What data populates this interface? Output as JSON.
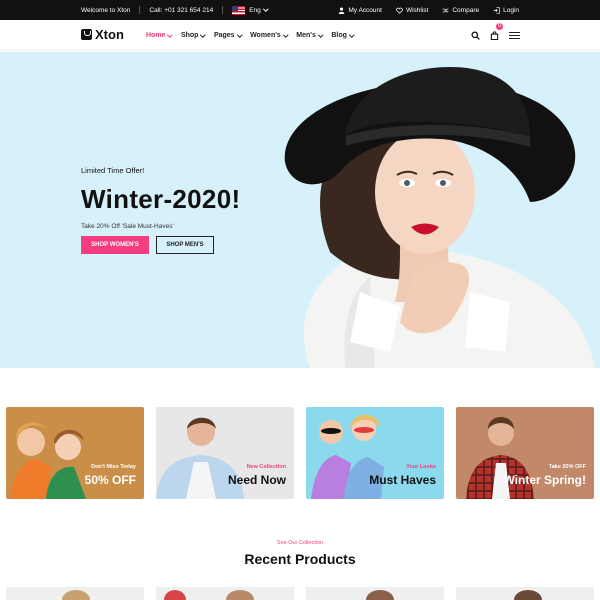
{
  "topbar": {
    "welcome": "Welcome to Xton",
    "call": "Call: +01 321 654 214",
    "language": "Eng",
    "links": [
      {
        "label": "My Account",
        "icon": "user-icon"
      },
      {
        "label": "Wishlist",
        "icon": "heart-icon"
      },
      {
        "label": "Compare",
        "icon": "shuffle-icon"
      },
      {
        "label": "Login",
        "icon": "login-icon"
      }
    ]
  },
  "nav": {
    "brand": "Xton",
    "menu": [
      "Home",
      "Shop",
      "Pages",
      "Women's",
      "Men's",
      "Blog"
    ],
    "active": "Home",
    "cart_count": "0"
  },
  "hero": {
    "eyebrow": "Limited Time Offer!",
    "title": "Winter-2020!",
    "subtitle": "Take 20% Off 'Sale Must-Haves'",
    "primary_button": "SHOP WOMEN'S",
    "secondary_button": "SHOP MEN'S"
  },
  "banners": [
    {
      "kicker": "Don't Miss Today",
      "title": "50% OFF",
      "kicker_color": "#ffffff",
      "title_color": "#ffffff"
    },
    {
      "kicker": "New Collection",
      "title": "Need Now",
      "kicker_color": "#f53d7f",
      "title_color": "#111111"
    },
    {
      "kicker": "Your Looks",
      "title": "Must Haves",
      "kicker_color": "#f53d7f",
      "title_color": "#111111"
    },
    {
      "kicker": "Take 20% OFF",
      "title": "Winter Spring!",
      "kicker_color": "#ffffff",
      "title_color": "#ffffff"
    }
  ],
  "section": {
    "eyebrow": "See Our Collection",
    "title": "Recent Products"
  },
  "colors": {
    "accent": "#f53d7f",
    "hero_bg": "#d7f1fb",
    "topbar_bg": "#111111"
  }
}
